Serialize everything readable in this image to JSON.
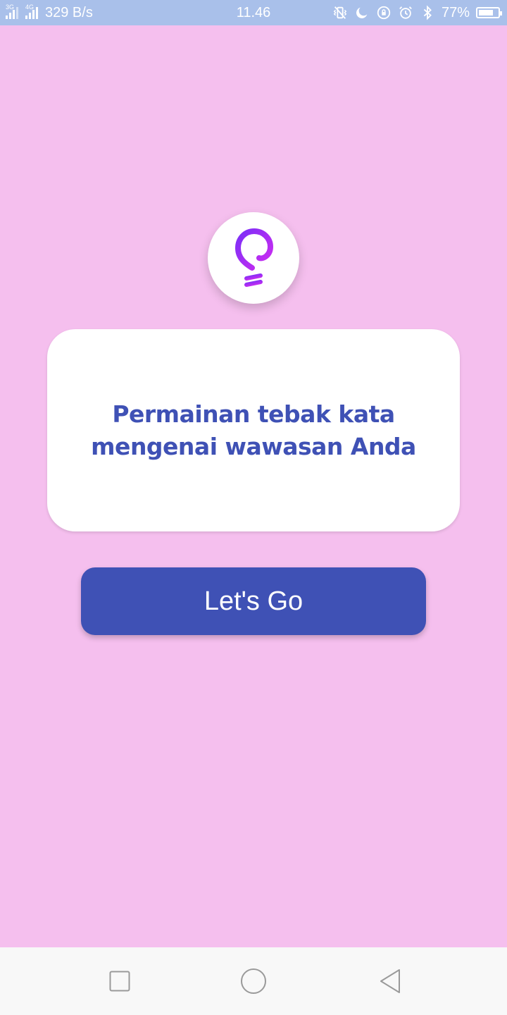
{
  "status_bar": {
    "network_1": "3G",
    "network_2": "4G",
    "speed": "329 B/s",
    "time": "11.46",
    "battery_level": "77%",
    "battery_fraction": 0.77,
    "icons": [
      "vibrate-icon",
      "moon-icon",
      "rotation-lock-icon",
      "alarm-icon",
      "bluetooth-icon"
    ]
  },
  "logo": {
    "icon": "lightbulb-icon",
    "color_start": "#7b2ff7",
    "color_end": "#d02cf0"
  },
  "card": {
    "line1": "Permainan tebak kata",
    "line2": "mengenai wawasan Anda"
  },
  "button": {
    "label": "Let's Go"
  },
  "nav_bar": {
    "icons": [
      "recent-apps-icon",
      "home-icon",
      "back-icon"
    ]
  },
  "colors": {
    "background": "#f5bfee",
    "status_bar": "#a9c0ea",
    "accent": "#3f51b5",
    "card": "#ffffff",
    "nav_bar": "#f8f8f8"
  }
}
